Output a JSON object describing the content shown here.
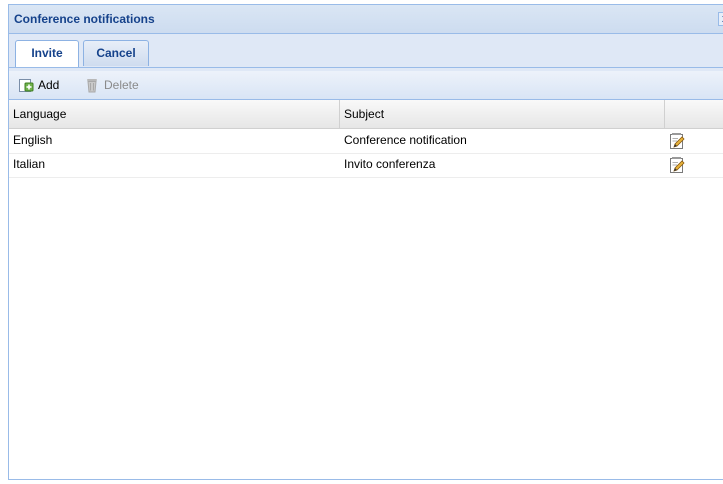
{
  "window": {
    "title": "Conference notifications",
    "close_label": "x"
  },
  "tabs": [
    {
      "label": "Invite",
      "active": true
    },
    {
      "label": "Cancel",
      "active": false
    }
  ],
  "toolbar": {
    "add_label": "Add",
    "add_icon": "add-icon",
    "delete_label": "Delete",
    "delete_icon": "trash-icon",
    "delete_enabled": false
  },
  "grid": {
    "columns": [
      "Language",
      "Subject",
      ""
    ],
    "rows": [
      {
        "language": "English",
        "subject": "Conference notification",
        "action_icon": "edit-icon"
      },
      {
        "language": "Italian",
        "subject": "Invito conferenza",
        "action_icon": "edit-icon"
      }
    ]
  },
  "colors": {
    "title_text": "#15428b",
    "window_bg": "#dfe8f6",
    "border": "#99bbe8"
  }
}
